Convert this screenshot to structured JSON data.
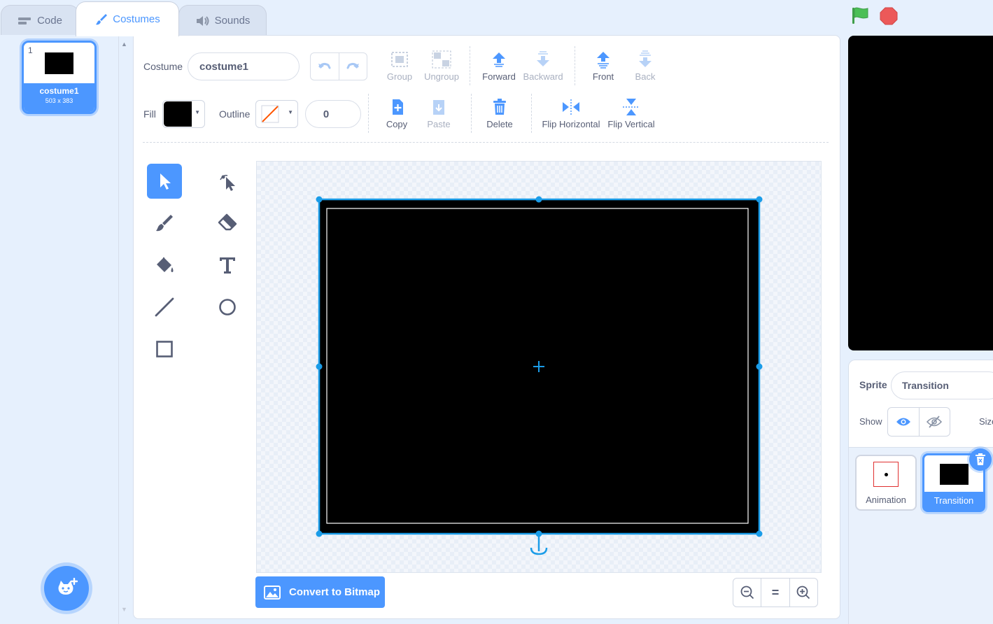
{
  "tabs": [
    {
      "label": "Code",
      "icon": "code-icon"
    },
    {
      "label": "Costumes",
      "icon": "paintbrush-icon"
    },
    {
      "label": "Sounds",
      "icon": "speaker-icon"
    }
  ],
  "costumes": [
    {
      "number": "1",
      "name": "costume1",
      "size": "503 x 383"
    }
  ],
  "toolbar": {
    "costume_label": "Costume",
    "costume_name": "costume1",
    "group": "Group",
    "ungroup": "Ungroup",
    "forward": "Forward",
    "backward": "Backward",
    "front": "Front",
    "back": "Back",
    "fill_label": "Fill",
    "outline_label": "Outline",
    "outline_width": "0",
    "copy": "Copy",
    "paste": "Paste",
    "delete": "Delete",
    "flip_horizontal": "Flip Horizontal",
    "flip_vertical": "Flip Vertical"
  },
  "colors": {
    "accent": "#4c97ff",
    "fill": "#000000",
    "outline_none_slash": "#ff5500",
    "green_flag": "#4cbf56",
    "stop": "#ec5959"
  },
  "tools": [
    "select",
    "reshape",
    "brush",
    "eraser",
    "fill",
    "text",
    "line",
    "circle",
    "rectangle"
  ],
  "bottom": {
    "convert_label": "Convert to Bitmap",
    "zoom_out": "zoom-out-icon",
    "zoom_reset": "=",
    "zoom_in": "zoom-in-icon"
  },
  "sprite_info": {
    "sprite_label": "Sprite",
    "sprite_name": "Transition",
    "show_label": "Show",
    "size_label": "Size"
  },
  "sprites": [
    {
      "name": "Animation",
      "selected": false
    },
    {
      "name": "Transition",
      "selected": true
    }
  ]
}
